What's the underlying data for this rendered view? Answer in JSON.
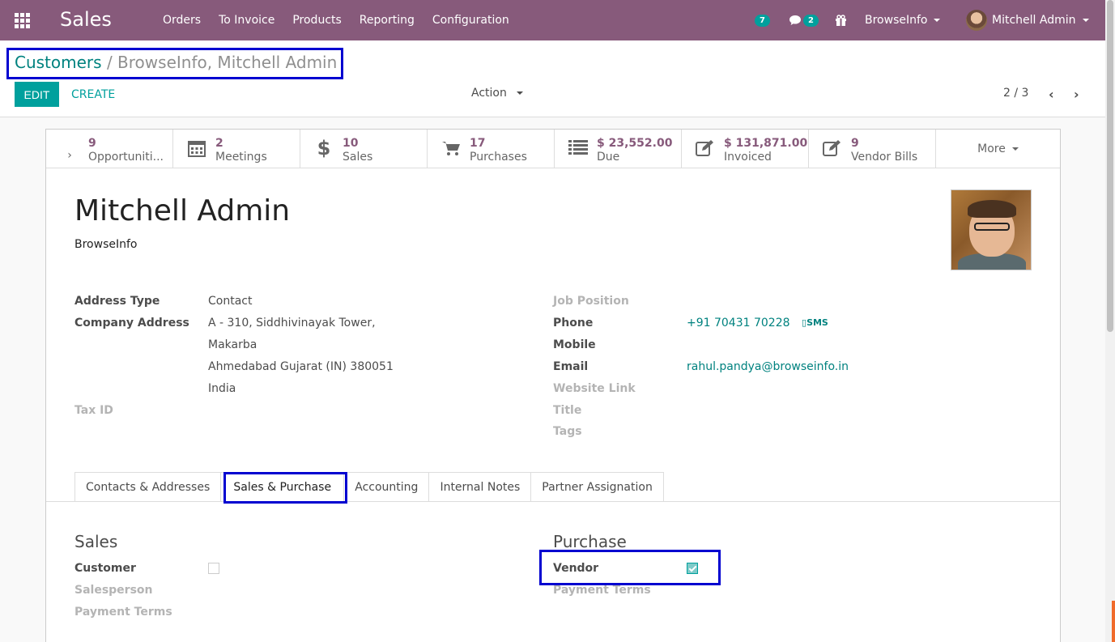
{
  "navbar": {
    "app_title": "Sales",
    "menu": [
      "Orders",
      "To Invoice",
      "Products",
      "Reporting",
      "Configuration"
    ],
    "activity_count": "7",
    "messages_count": "2",
    "company_switcher": "BrowseInfo",
    "user_name": "Mitchell Admin",
    "colors": {
      "navbar_bg": "#875a7b",
      "accent": "#00a09d"
    }
  },
  "control_panel": {
    "breadcrumb_parent": "Customers",
    "breadcrumb_separator": "/",
    "breadcrumb_current": "BrowseInfo, Mitchell Admin",
    "edit_label": "EDIT",
    "create_label": "CREATE",
    "action_label": "Action",
    "pager": "2 / 3"
  },
  "stat_buttons": [
    {
      "value": "9",
      "label": "Opportuniti...",
      "icon": "star-icon"
    },
    {
      "value": "2",
      "label": "Meetings",
      "icon": "calendar-icon"
    },
    {
      "value": "10",
      "label": "Sales",
      "icon": "dollar-icon"
    },
    {
      "value": "17",
      "label": "Purchases",
      "icon": "cart-icon"
    },
    {
      "value": "$ 23,552.00",
      "label": "Due",
      "icon": "list-icon"
    },
    {
      "value": "$ 131,871.00",
      "label": "Invoiced",
      "icon": "edit-icon"
    },
    {
      "value": "9",
      "label": "Vendor Bills",
      "icon": "edit-icon"
    }
  ],
  "more_label": "More",
  "partner": {
    "name": "Mitchell Admin",
    "company": "BrowseInfo"
  },
  "left_fields": {
    "address_type_label": "Address Type",
    "address_type_value": "Contact",
    "company_address_label": "Company Address",
    "address_line1": "A - 310, Siddhivinayak Tower,",
    "address_line2": "Makarba",
    "address_line3": "Ahmedabad  Gujarat (IN)  380051",
    "address_line4": "India",
    "tax_id_label": "Tax ID"
  },
  "right_fields": {
    "job_position_label": "Job Position",
    "phone_label": "Phone",
    "phone_value": "+91 70431 70228",
    "sms_label": "SMS",
    "mobile_label": "Mobile",
    "email_label": "Email",
    "email_value": "rahul.pandya@browseinfo.in",
    "website_label": "Website Link",
    "title_label": "Title",
    "tags_label": "Tags"
  },
  "tabs": [
    "Contacts & Addresses",
    "Sales & Purchase",
    "Accounting",
    "Internal Notes",
    "Partner Assignation"
  ],
  "active_tab": "Sales & Purchase",
  "sales_section": {
    "title": "Sales",
    "customer_label": "Customer",
    "customer_checked": false,
    "salesperson_label": "Salesperson",
    "payment_terms_label": "Payment Terms"
  },
  "purchase_section": {
    "title": "Purchase",
    "vendor_label": "Vendor",
    "vendor_checked": true,
    "payment_terms_label": "Payment Terms"
  }
}
